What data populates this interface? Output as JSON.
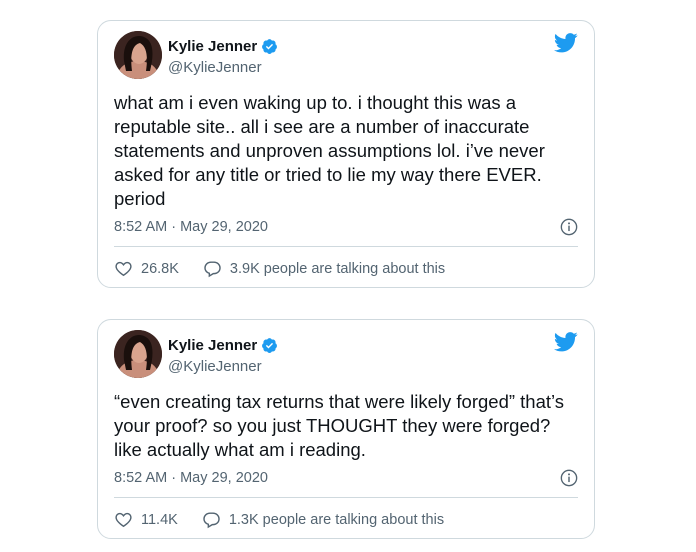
{
  "colors": {
    "accent": "#1d9bf0",
    "text": "#0f1419",
    "muted": "#536471",
    "border": "#cfd9de"
  },
  "tweets": [
    {
      "author": {
        "name": "Kylie Jenner",
        "handle": "@KylieJenner",
        "verified": true
      },
      "text": "what am i even waking up to. i thought this was a\nreputable site.. all i see are a number of inaccurate\nstatements and unproven assumptions lol. i’ve never\nasked for any title or tried to lie my way there EVER.\nperiod",
      "timestamp": "8:52 AM · May 29, 2020",
      "likes": "26.8K",
      "talking": "3.9K people are talking about this",
      "icons": {
        "like": "heart-icon",
        "talk": "speech-bubble-icon",
        "info": "info-icon",
        "brand": "twitter-bird-icon"
      }
    },
    {
      "author": {
        "name": "Kylie Jenner",
        "handle": "@KylieJenner",
        "verified": true
      },
      "text": "“even creating tax returns that were likely forged” that’s\nyour proof? so you just THOUGHT they were forged?\nlike actually what am i reading.",
      "timestamp": "8:52 AM · May 29, 2020",
      "likes": "11.4K",
      "talking": "1.3K people are talking about this",
      "icons": {
        "like": "heart-icon",
        "talk": "speech-bubble-icon",
        "info": "info-icon",
        "brand": "twitter-bird-icon"
      }
    }
  ]
}
